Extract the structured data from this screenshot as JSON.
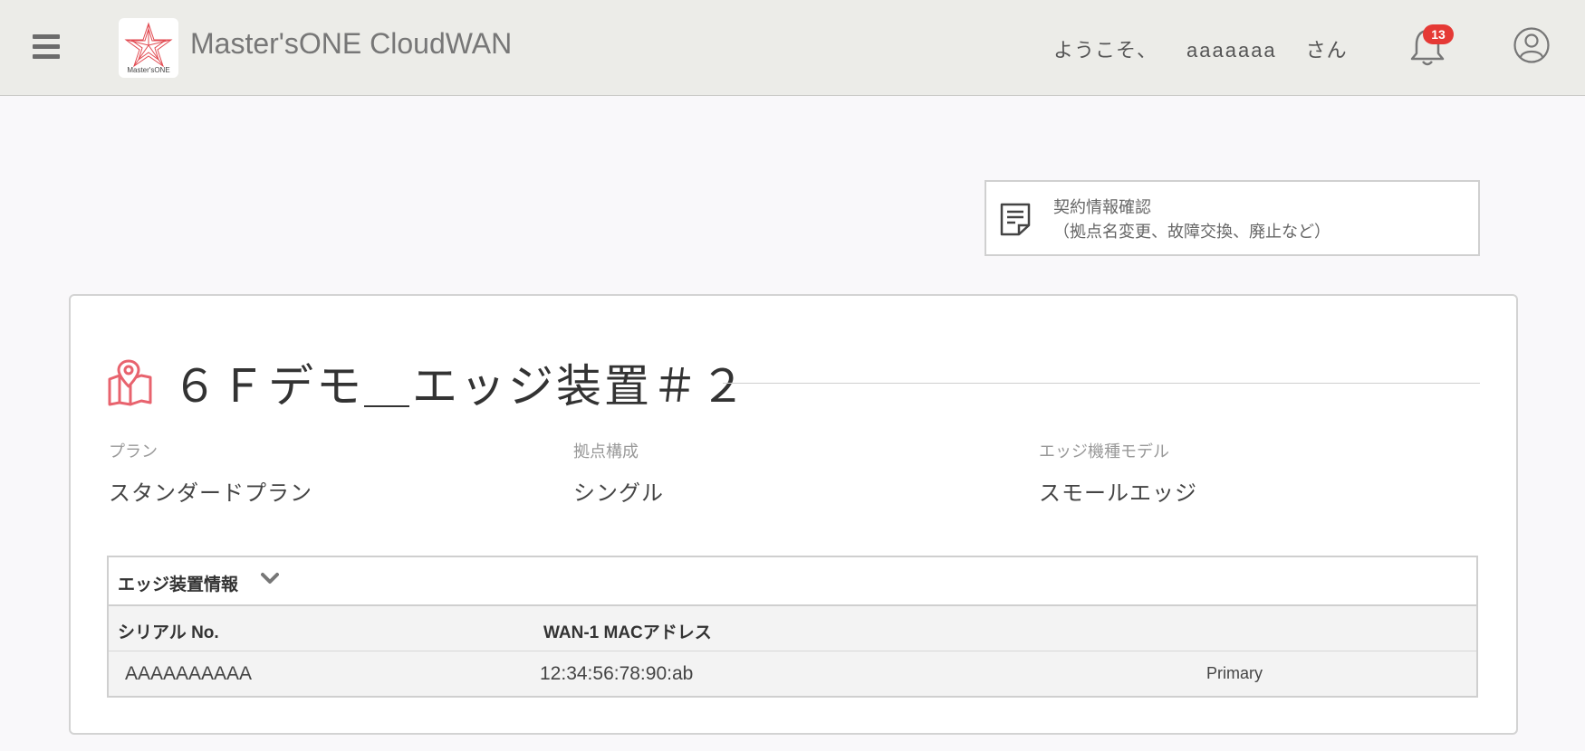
{
  "header": {
    "app_title": "Master'sONE CloudWAN",
    "logo_text": "Master'sONE",
    "welcome_prefix": "ようこそ、",
    "username": "aaaaaaa",
    "welcome_suffix": "さん",
    "notification_count": "13",
    "colors": {
      "background": "#ecece8",
      "badge": "#e53935"
    }
  },
  "contract_button": {
    "line1": "契約情報確認",
    "line2": "（拠点名変更、故障交換、廃止など）"
  },
  "site": {
    "title": "６Ｆデモ＿エッジ装置＃２",
    "icon": "map-pin-icon",
    "accent": "#e8636e",
    "fields": [
      {
        "label": "プラン",
        "value": "スタンダードプラン"
      },
      {
        "label": "拠点構成",
        "value": "シングル"
      },
      {
        "label": "エッジ機種モデル",
        "value": "スモールエッジ"
      }
    ]
  },
  "edge_panel": {
    "title": "エッジ装置情報",
    "columns": [
      "シリアル No.",
      "WAN-1 MACアドレス"
    ],
    "rows": [
      {
        "serial": "AAAAAAAAAA",
        "mac": "12:34:56:78:90:ab",
        "role": "Primary"
      }
    ]
  }
}
